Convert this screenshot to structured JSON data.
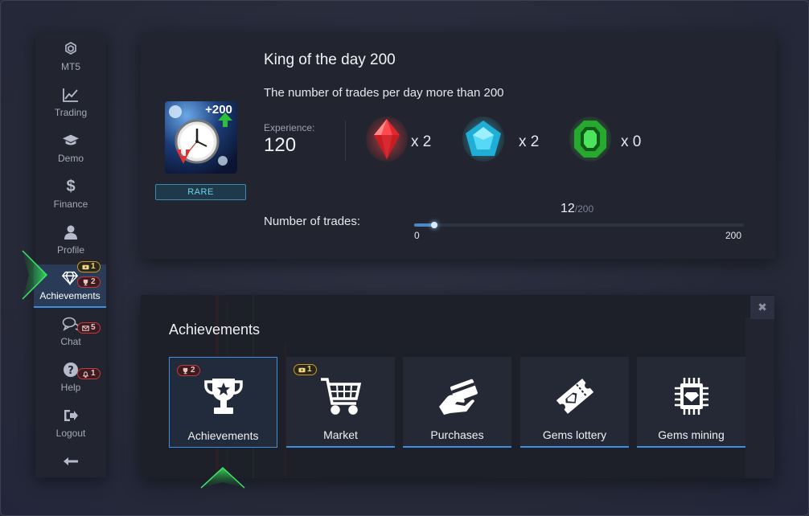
{
  "sidebar": {
    "items": [
      {
        "label": "MT5",
        "icon": "mt5-icon"
      },
      {
        "label": "Trading",
        "icon": "chart-line-icon"
      },
      {
        "label": "Demo",
        "icon": "graduation-cap-icon"
      },
      {
        "label": "Finance",
        "icon": "dollar-icon"
      },
      {
        "label": "Profile",
        "icon": "user-icon"
      },
      {
        "label": "Achievements",
        "icon": "diamond-icon",
        "badges": [
          {
            "count": "1",
            "icon": "ticket-icon"
          },
          {
            "count": "2",
            "icon": "trophy-icon"
          }
        ]
      },
      {
        "label": "Chat",
        "icon": "chat-icon",
        "badges": [
          {
            "count": "5",
            "icon": "mail-icon"
          }
        ]
      },
      {
        "label": "Help",
        "icon": "question-icon",
        "badges": [
          {
            "count": "1",
            "icon": "bell-icon"
          }
        ]
      },
      {
        "label": "Logout",
        "icon": "logout-icon"
      }
    ],
    "collapse_icon": "arrow-left-icon"
  },
  "achievement": {
    "title": "King of the day 200",
    "description": "The number of trades per day more than 200",
    "image_badge": "+200",
    "rarity": "RARE",
    "experience_label": "Experience:",
    "experience_value": "120",
    "rewards": [
      {
        "gem": "red-gem-icon",
        "count": "x 2",
        "color": "#e5323a"
      },
      {
        "gem": "blue-gem-icon",
        "count": "x 2",
        "color": "#2ec4e8"
      },
      {
        "gem": "green-gem-icon",
        "count": "x 0",
        "color": "#38c23c"
      }
    ],
    "trades_label": "Number of trades:",
    "progress_current": "12",
    "progress_max": "/200",
    "progress_fraction": 0.06,
    "range_min": "0",
    "range_max": "200"
  },
  "panel": {
    "title": "Achievements",
    "close_icon": "close-icon",
    "tiles": [
      {
        "label": "Achievements",
        "icon": "trophy-icon",
        "badge": "2",
        "badge_type": "red"
      },
      {
        "label": "Market",
        "icon": "cart-icon",
        "badge": "1",
        "badge_type": "gold"
      },
      {
        "label": "Purchases",
        "icon": "card-hand-icon"
      },
      {
        "label": "Gems lottery",
        "icon": "ticket-gem-icon"
      },
      {
        "label": "Gems mining",
        "icon": "chip-gem-icon"
      }
    ]
  },
  "colors": {
    "accent": "#3f8fe0",
    "rare": "#6fd0f0",
    "pointer": "#2fb84a"
  }
}
